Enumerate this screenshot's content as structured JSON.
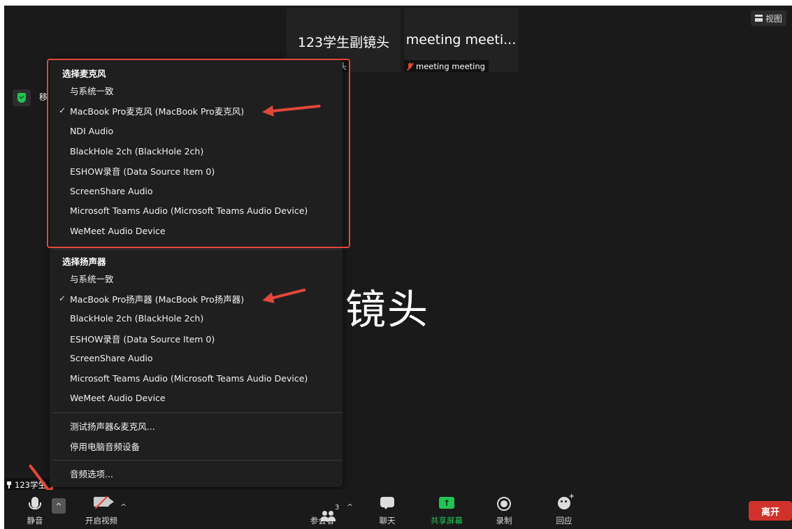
{
  "thumbnails": [
    {
      "name": "123学生副镜头",
      "tag": "头"
    },
    {
      "name": "meeting meeti...",
      "tag": "meeting meeting"
    }
  ],
  "view_button": {
    "label": "视图"
  },
  "security_label": "移",
  "main_video": {
    "label": "学生主镜头"
  },
  "pinned_label": "123学生",
  "audio_menu": {
    "microphone_title": "选择麦克风",
    "microphones": [
      {
        "label": "与系统一致",
        "selected": false
      },
      {
        "label": "MacBook Pro麦克风 (MacBook Pro麦克风)",
        "selected": true
      },
      {
        "label": "NDI Audio",
        "selected": false
      },
      {
        "label": "BlackHole 2ch (BlackHole 2ch)",
        "selected": false
      },
      {
        "label": "ESHOW录音 (Data Source Item 0)",
        "selected": false
      },
      {
        "label": "ScreenShare Audio",
        "selected": false
      },
      {
        "label": "Microsoft Teams Audio (Microsoft Teams Audio Device)",
        "selected": false
      },
      {
        "label": "WeMeet Audio Device",
        "selected": false
      }
    ],
    "speaker_title": "选择扬声器",
    "speakers": [
      {
        "label": "与系统一致",
        "selected": false
      },
      {
        "label": "MacBook Pro扬声器 (MacBook Pro扬声器)",
        "selected": true
      },
      {
        "label": "BlackHole 2ch (BlackHole 2ch)",
        "selected": false
      },
      {
        "label": "ESHOW录音 (Data Source Item 0)",
        "selected": false
      },
      {
        "label": "ScreenShare Audio",
        "selected": false
      },
      {
        "label": "Microsoft Teams Audio (Microsoft Teams Audio Device)",
        "selected": false
      },
      {
        "label": "WeMeet Audio Device",
        "selected": false
      }
    ],
    "check_mark": "✓",
    "test_audio": "测试扬声器&麦克风...",
    "disable_audio": "停用电脑音频设备",
    "audio_options": "音频选项..."
  },
  "toolbar": {
    "mute": "静音",
    "start_video": "开启视频",
    "participants": "参会者",
    "participant_count": "3",
    "chat": "聊天",
    "share_screen": "共享屏幕",
    "record": "录制",
    "reactions": "回应",
    "leave": "离开",
    "caret": "^"
  },
  "colors": {
    "annotation_red": "#e2473a",
    "share_green": "#23c552",
    "leave_red": "#d0322b",
    "background": "#1a1a1a",
    "menu_background": "#1f1f1f"
  }
}
